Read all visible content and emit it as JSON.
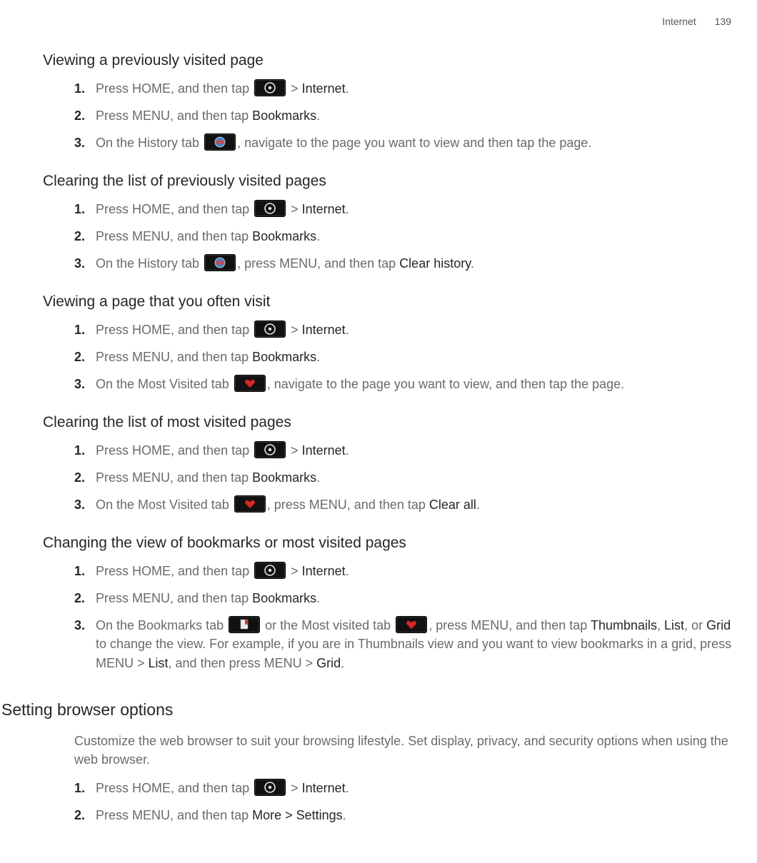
{
  "header": {
    "section_label": "Internet",
    "page_number": "139"
  },
  "txt": {
    "press_home_tap": "Press HOME, and then tap ",
    "gt": " > ",
    "internet": "Internet",
    "dot": ".",
    "press_menu_tap": "Press MENU, and then tap ",
    "bookmarks": "Bookmarks",
    "on_history_tab": "On the History tab ",
    "nav_page_tap": ", navigate to the page you want to view and then tap the page.",
    "press_menu_then_tap": ", press MENU, and then tap ",
    "clear_history": "Clear history",
    "on_most_visited_tab": "On the Most Visited tab ",
    "nav_page_tap2": ", navigate to the page you want to view, and then tap the page.",
    "clear_all": "Clear all",
    "on_bookmarks_tab": "On the Bookmarks tab ",
    "or_most_visited_tab": " or the Most visited tab ",
    "change_view_pre": "Thumbnails",
    "comma_sp": ", ",
    "list": "List",
    "or_sp": ", or ",
    "grid": "Grid",
    "change_view_mid": " to change the view. For example, if you are in Thumbnails view and you want to view bookmarks in a grid, press MENU > ",
    "and_then_press_menu": ", and then press MENU > ",
    "more_settings": "More > Settings"
  },
  "sections": {
    "s1": {
      "title": "Viewing a previously visited page"
    },
    "s2": {
      "title": "Clearing the list of previously visited pages"
    },
    "s3": {
      "title": "Viewing a page that you often visit"
    },
    "s4": {
      "title": "Clearing the list of most visited pages"
    },
    "s5": {
      "title": "Changing the view of bookmarks or most visited pages"
    },
    "s6": {
      "title": "Setting browser options",
      "intro": "Customize the web browser to suit your browsing lifestyle. Set display, privacy, and security options when using the web browser."
    }
  }
}
